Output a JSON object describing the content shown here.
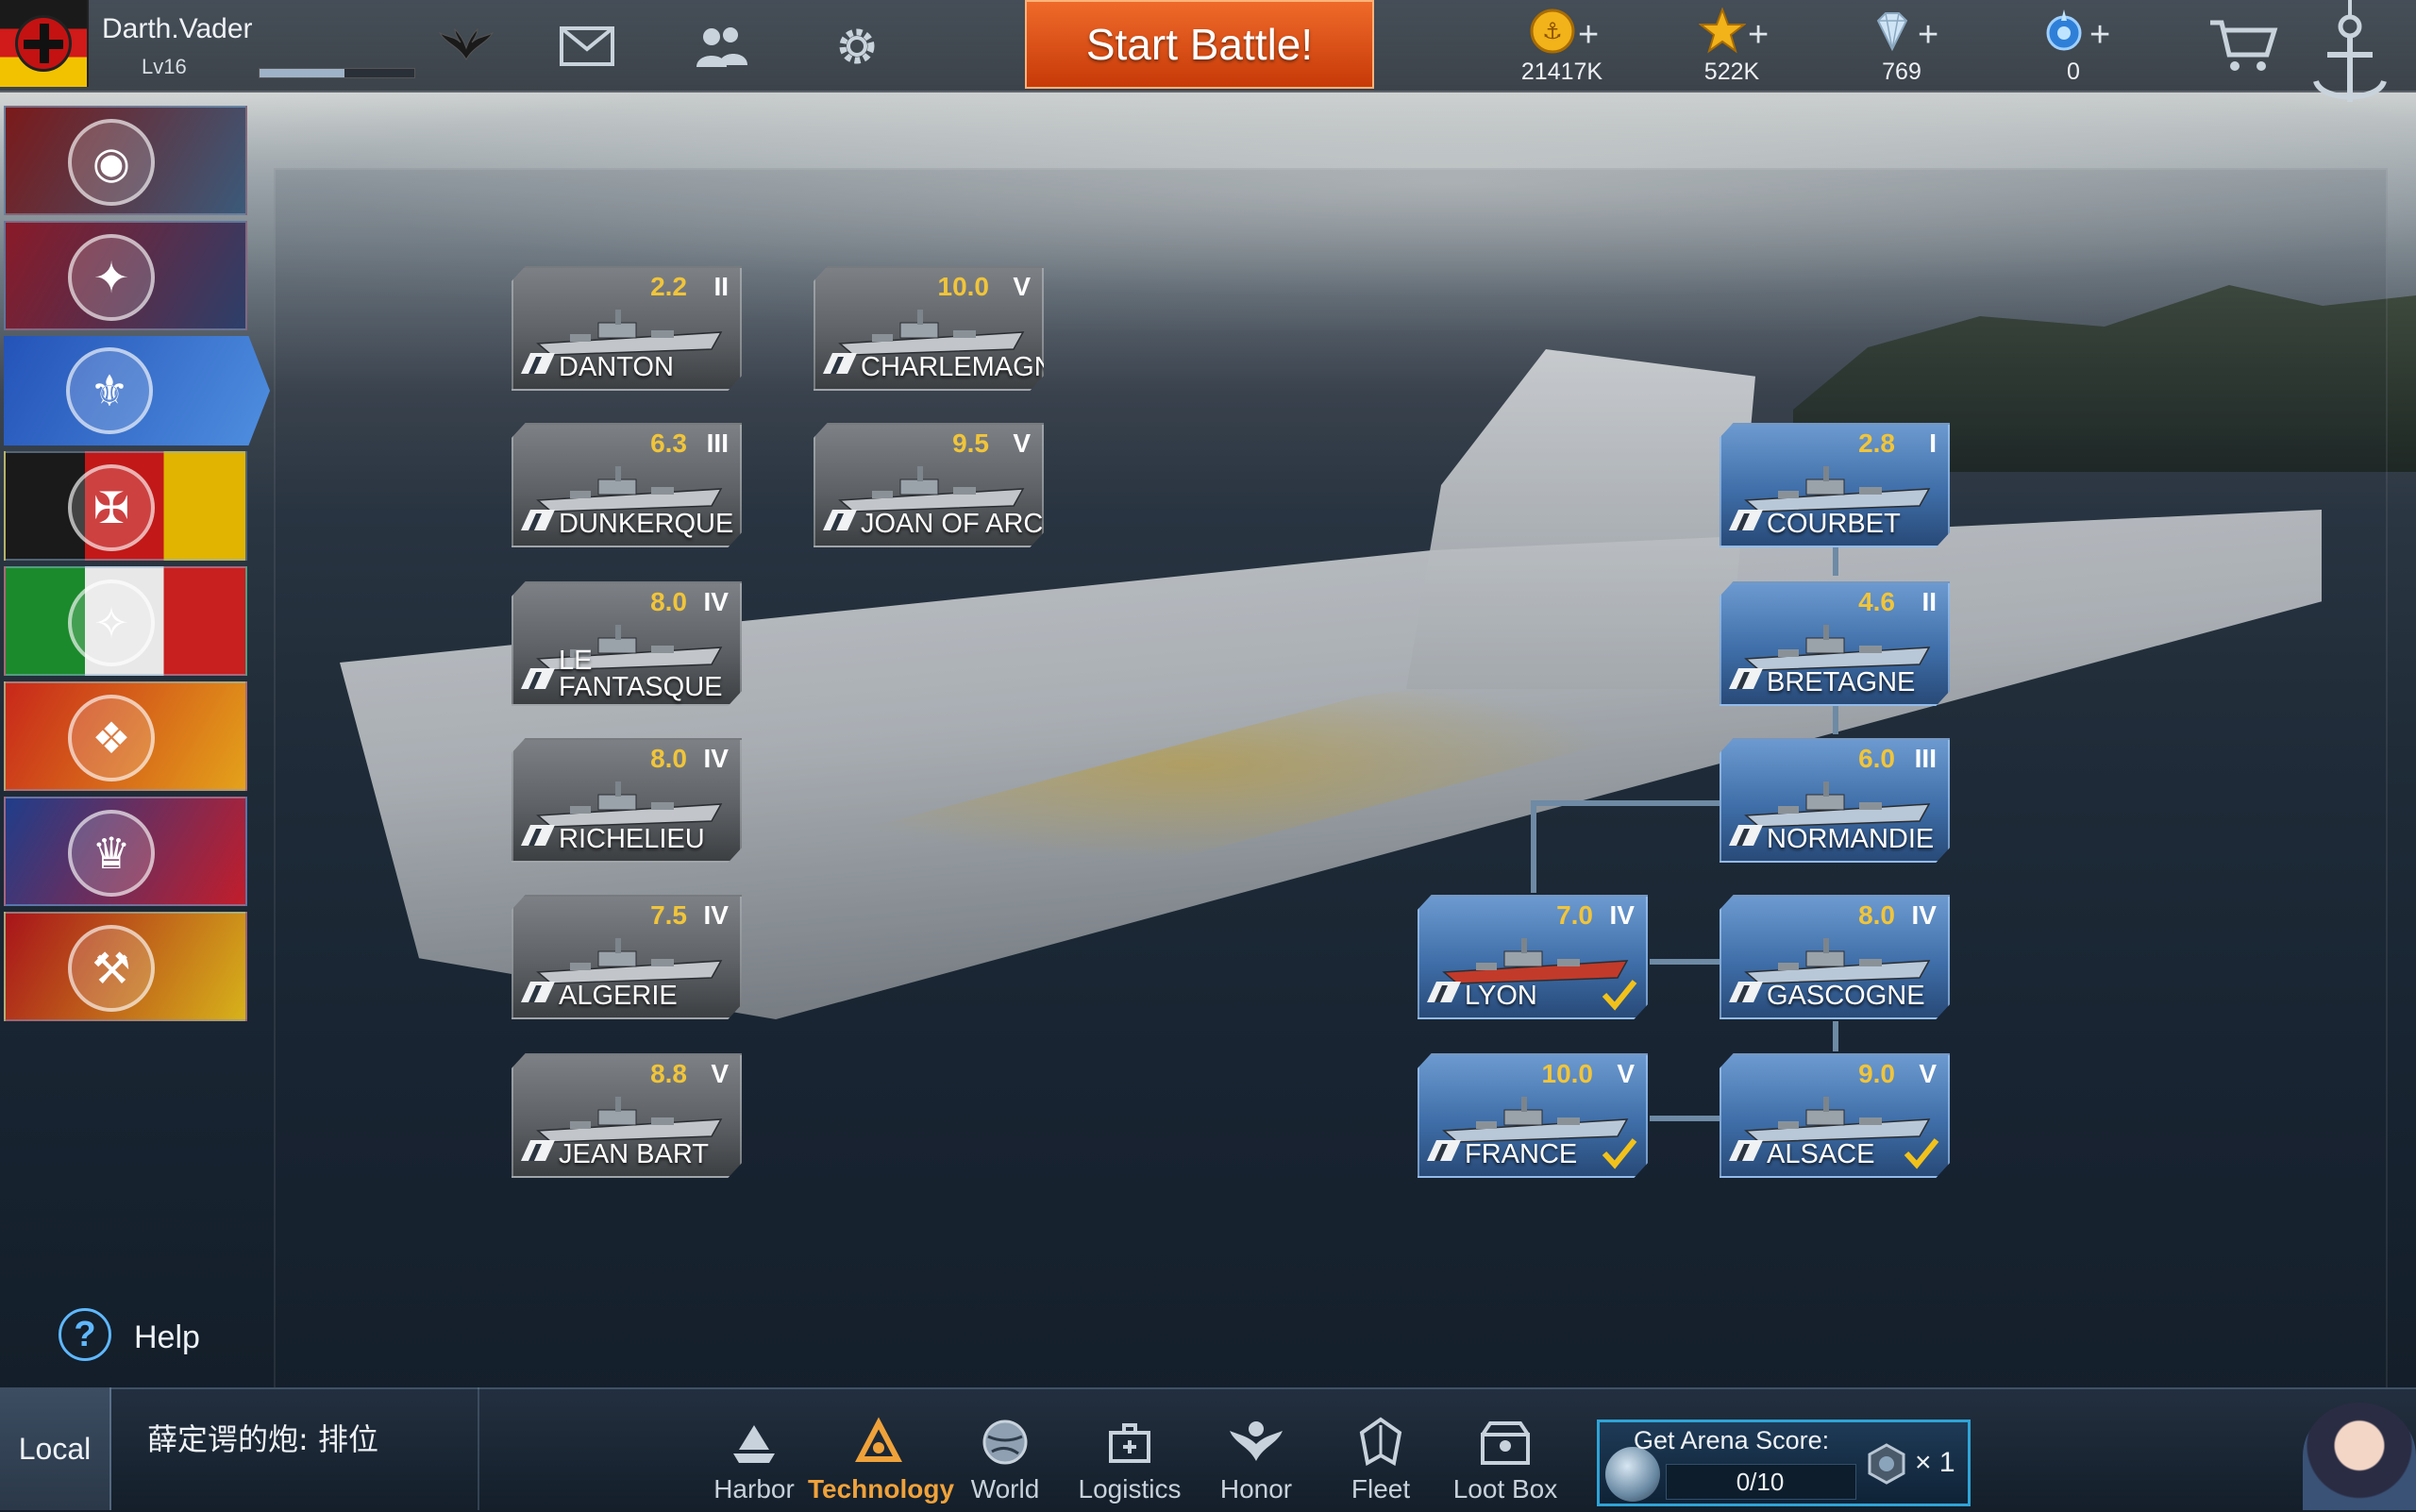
{
  "player": {
    "name": "Darth.Vader",
    "level": "Lv16",
    "xp_progress": 0.55
  },
  "top_icons": [
    "wings-icon",
    "mail-icon",
    "friends-icon",
    "settings-gear-icon"
  ],
  "start_battle_label": "Start Battle!",
  "currencies": [
    {
      "icon": "gold-coin-icon",
      "value": "21417K",
      "color": "#f2b21a"
    },
    {
      "icon": "star-icon",
      "value": "522K",
      "color": "#f2b21a"
    },
    {
      "icon": "diamond-icon",
      "value": "769",
      "color": "#cfe4f5"
    },
    {
      "icon": "blue-gem-icon",
      "value": "0",
      "color": "#3a8ee8"
    }
  ],
  "nations": [
    {
      "id": "nation-first",
      "colors": [
        "#7a1a1a",
        "#3a5a7a"
      ],
      "emblem": "wave-emblem-icon",
      "active": false
    },
    {
      "id": "nation-usa",
      "colors": [
        "#8a1a28",
        "#2c3f6a"
      ],
      "emblem": "eagle-emblem-icon",
      "active": false
    },
    {
      "id": "nation-france",
      "colors": [
        "#2453b8",
        "#4f8fe0"
      ],
      "emblem": "fleur-de-lis-emblem-icon",
      "active": true
    },
    {
      "id": "nation-germany",
      "colors": [
        "#1a1a1a",
        "#c21818",
        "#e0b400"
      ],
      "emblem": "iron-cross-emblem-icon",
      "active": false
    },
    {
      "id": "nation-italy",
      "colors": [
        "#1b8a2c",
        "#e8e8e8",
        "#c81f1f"
      ],
      "emblem": "star-emblem-icon",
      "active": false
    },
    {
      "id": "nation-china",
      "colors": [
        "#c8281a",
        "#e4a21a"
      ],
      "emblem": "dragon-emblem-icon",
      "active": false
    },
    {
      "id": "nation-uk",
      "colors": [
        "#1f3d8a",
        "#c21d2b"
      ],
      "emblem": "crown-emblem-icon",
      "active": false
    },
    {
      "id": "nation-ussr",
      "colors": [
        "#a8141a",
        "#d7b21a"
      ],
      "emblem": "hammer-sickle-emblem-icon",
      "active": false
    }
  ],
  "help_label": "Help",
  "ships": [
    {
      "name": "DANTON",
      "rating": "2.2",
      "tier": "II",
      "researched": false,
      "checked": false
    },
    {
      "name": "CHARLEMAGNE",
      "rating": "10.0",
      "tier": "V",
      "researched": false,
      "checked": false
    },
    {
      "name": "DUNKERQUE",
      "rating": "6.3",
      "tier": "III",
      "researched": false,
      "checked": false
    },
    {
      "name": "JOAN OF ARC",
      "rating": "9.5",
      "tier": "V",
      "researched": false,
      "checked": false
    },
    {
      "name": "LE FANTASQUE",
      "rating": "8.0",
      "tier": "IV",
      "researched": false,
      "checked": false,
      "two_line": true
    },
    {
      "name": "RICHELIEU",
      "rating": "8.0",
      "tier": "IV",
      "researched": false,
      "checked": false
    },
    {
      "name": "ALGERIE",
      "rating": "7.5",
      "tier": "IV",
      "researched": false,
      "checked": false
    },
    {
      "name": "JEAN BART",
      "rating": "8.8",
      "tier": "V",
      "researched": false,
      "checked": false
    },
    {
      "name": "COURBET",
      "rating": "2.8",
      "tier": "I",
      "researched": true,
      "checked": false
    },
    {
      "name": "BRETAGNE",
      "rating": "4.6",
      "tier": "II",
      "researched": true,
      "checked": false
    },
    {
      "name": "NORMANDIE",
      "rating": "6.0",
      "tier": "III",
      "researched": true,
      "checked": false
    },
    {
      "name": "LYON",
      "rating": "7.0",
      "tier": "IV",
      "researched": true,
      "checked": true
    },
    {
      "name": "GASCOGNE",
      "rating": "8.0",
      "tier": "IV",
      "researched": true,
      "checked": false
    },
    {
      "name": "FRANCE",
      "rating": "10.0",
      "tier": "V",
      "researched": true,
      "checked": true
    },
    {
      "name": "ALSACE",
      "rating": "9.0",
      "tier": "V",
      "researched": true,
      "checked": true
    }
  ],
  "bottom": {
    "local_label": "Local",
    "chat_message": "薛定谔的炮: 排位",
    "nav": [
      {
        "label": "Harbor",
        "icon": "harbor-ship-icon",
        "active": false
      },
      {
        "label": "Technology",
        "icon": "technology-icon",
        "active": true
      },
      {
        "label": "World",
        "icon": "world-globe-icon",
        "active": false
      },
      {
        "label": "Logistics",
        "icon": "logistics-icon",
        "active": false
      },
      {
        "label": "Honor",
        "icon": "honor-wings-icon",
        "active": false
      },
      {
        "label": "Fleet",
        "icon": "fleet-icon",
        "active": false
      },
      {
        "label": "Loot Box",
        "icon": "loot-box-icon",
        "active": false
      }
    ],
    "arena": {
      "title": "Get Arena Score:",
      "progress": "0/10",
      "multiplier": "× 1"
    }
  },
  "colors": {
    "accent_orange": "#e0561a",
    "rating_gold": "#f1c53a",
    "active_nav": "#f0a23a",
    "researched_blue": "#3f6ea8",
    "arena_border": "#2ea4d8"
  }
}
